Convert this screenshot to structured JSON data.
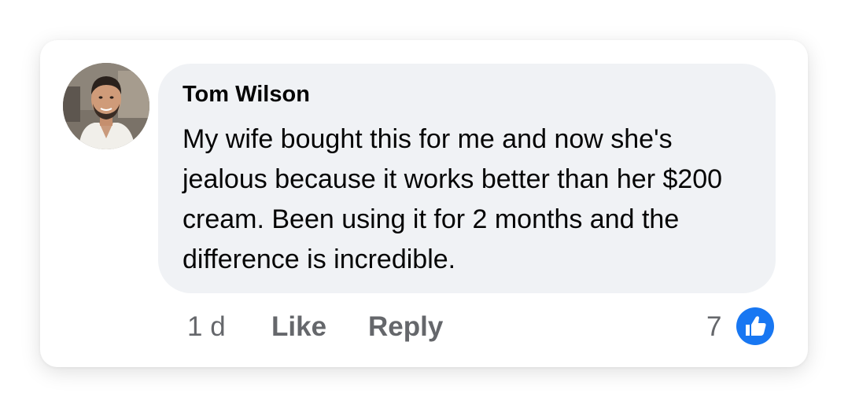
{
  "comment": {
    "author": "Tom Wilson",
    "text": "My wife bought this for me and now she's jealous because it works better than her $200 cream. Been using it for 2 months and the difference is incredible.",
    "timestamp": "1 d",
    "actions": {
      "like_label": "Like",
      "reply_label": "Reply"
    },
    "reactions": {
      "count": "7",
      "icon": "thumbs-up-icon",
      "icon_color": "#1877f2"
    }
  }
}
